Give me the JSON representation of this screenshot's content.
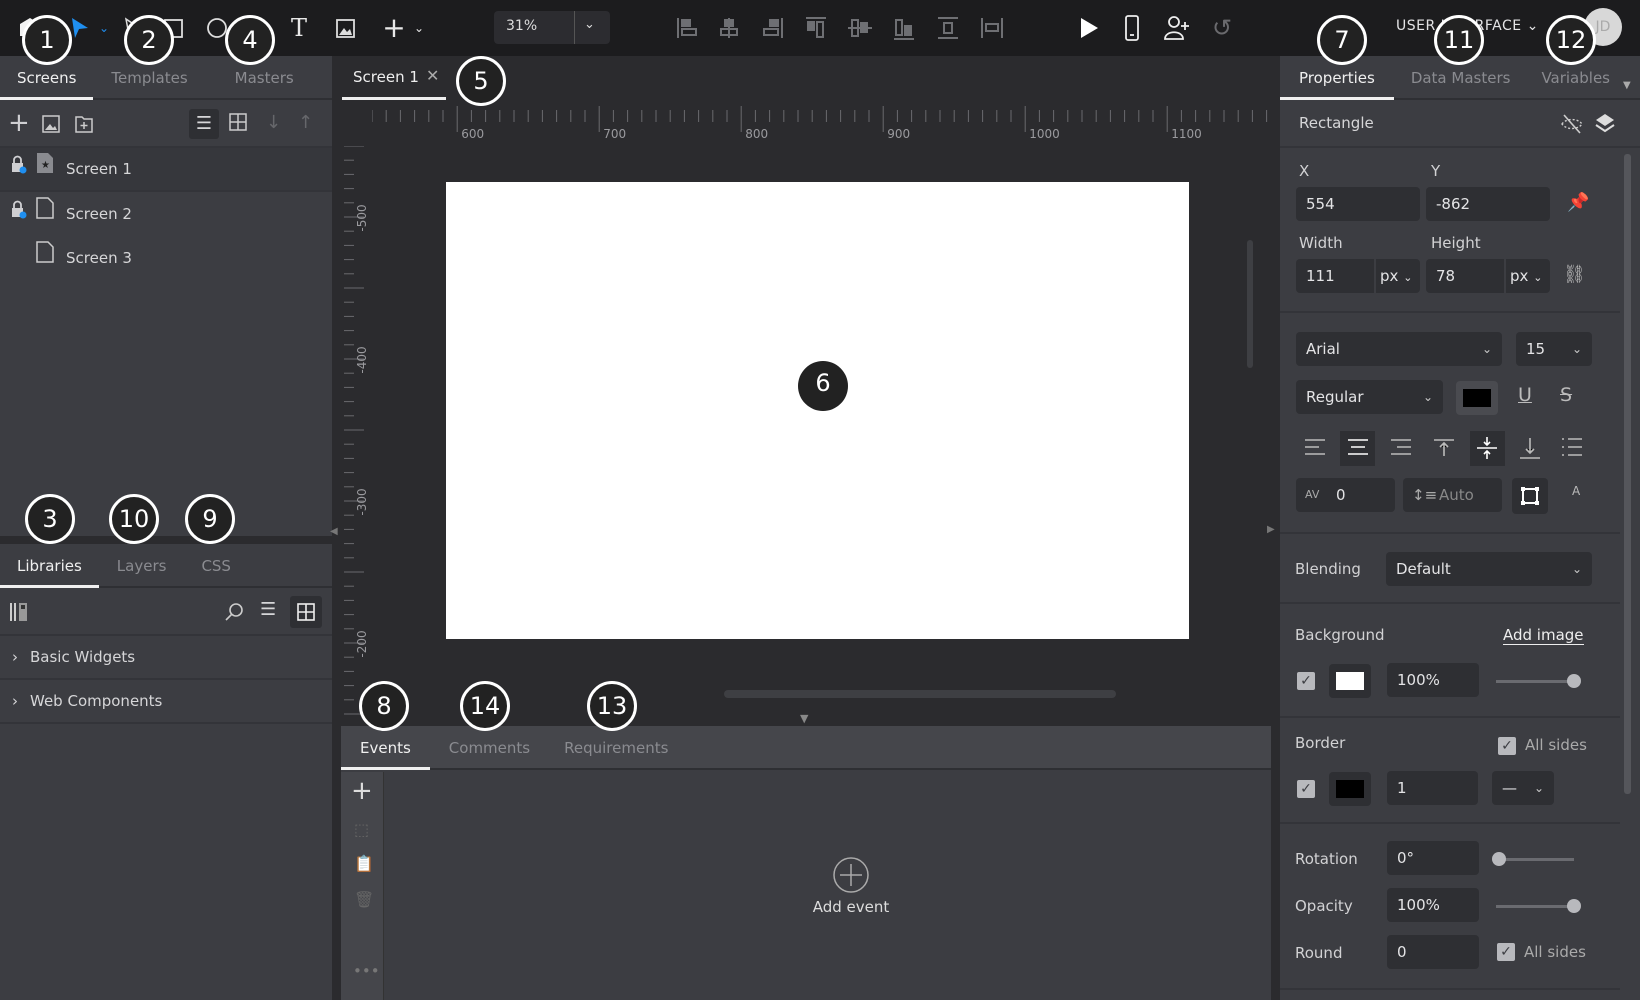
{
  "toolbar": {
    "zoom": "31%",
    "user_menu": "USER INTERFACE",
    "avatar": "JD",
    "tool_icons": [
      "logo-icon",
      "pointer-icon",
      "hotspot-icon",
      "rectangle-icon",
      "ellipse-icon",
      "text-icon",
      "image-icon",
      "add-icon"
    ],
    "align_icons": [
      "align-left-icon",
      "align-center-h-icon",
      "align-right-icon",
      "align-top-icon",
      "align-middle-icon",
      "align-bottom-icon",
      "distribute-v-icon",
      "distribute-h-icon"
    ]
  },
  "left": {
    "tabs": [
      "Screens",
      "Templates",
      "Masters"
    ],
    "screens": [
      {
        "label": "Screen 1",
        "locked": true,
        "home": true
      },
      {
        "label": "Screen 2",
        "locked": true,
        "home": false
      },
      {
        "label": "Screen 3",
        "locked": false,
        "home": false
      }
    ],
    "bottom_tabs": [
      "Libraries",
      "Layers",
      "CSS"
    ],
    "libraries": [
      "Basic Widgets",
      "Web Components"
    ]
  },
  "canvas": {
    "tab": "Screen 1",
    "ruler_x": [
      "600",
      "700",
      "800",
      "900",
      "1000",
      "1100"
    ],
    "ruler_y": [
      "-500",
      "-400",
      "-300",
      "-200"
    ]
  },
  "bottom": {
    "tabs": [
      "Events",
      "Comments",
      "Requirements"
    ],
    "add_event": "Add event"
  },
  "right": {
    "tabs": [
      "Properties",
      "Data Masters",
      "Variables"
    ],
    "element": "Rectangle",
    "x_label": "X",
    "x": "554",
    "y_label": "Y",
    "y": "-862",
    "w_label": "Width",
    "w": "111",
    "w_unit": "px",
    "h_label": "Height",
    "h": "78",
    "h_unit": "px",
    "font": "Arial",
    "font_size": "15",
    "font_weight": "Regular",
    "text_color": "#000000",
    "letter_spacing": "0",
    "line_height": "Auto",
    "blending_label": "Blending",
    "blending": "Default",
    "background_label": "Background",
    "add_image": "Add image",
    "bg_color": "#ffffff",
    "bg_opacity": "100%",
    "bg_opacity_value": 100,
    "border_label": "Border",
    "border_all_sides": "All sides",
    "border_color": "#000000",
    "border_width": "1",
    "rotation_label": "Rotation",
    "rotation": "0°",
    "opacity_label": "Opacity",
    "opacity": "100%",
    "opacity_value": 100,
    "round_label": "Round",
    "round": "0",
    "round_all_sides": "All sides"
  },
  "annotations": [
    "1",
    "2",
    "3",
    "4",
    "5",
    "6",
    "7",
    "8",
    "9",
    "10",
    "11",
    "12",
    "13",
    "14"
  ]
}
